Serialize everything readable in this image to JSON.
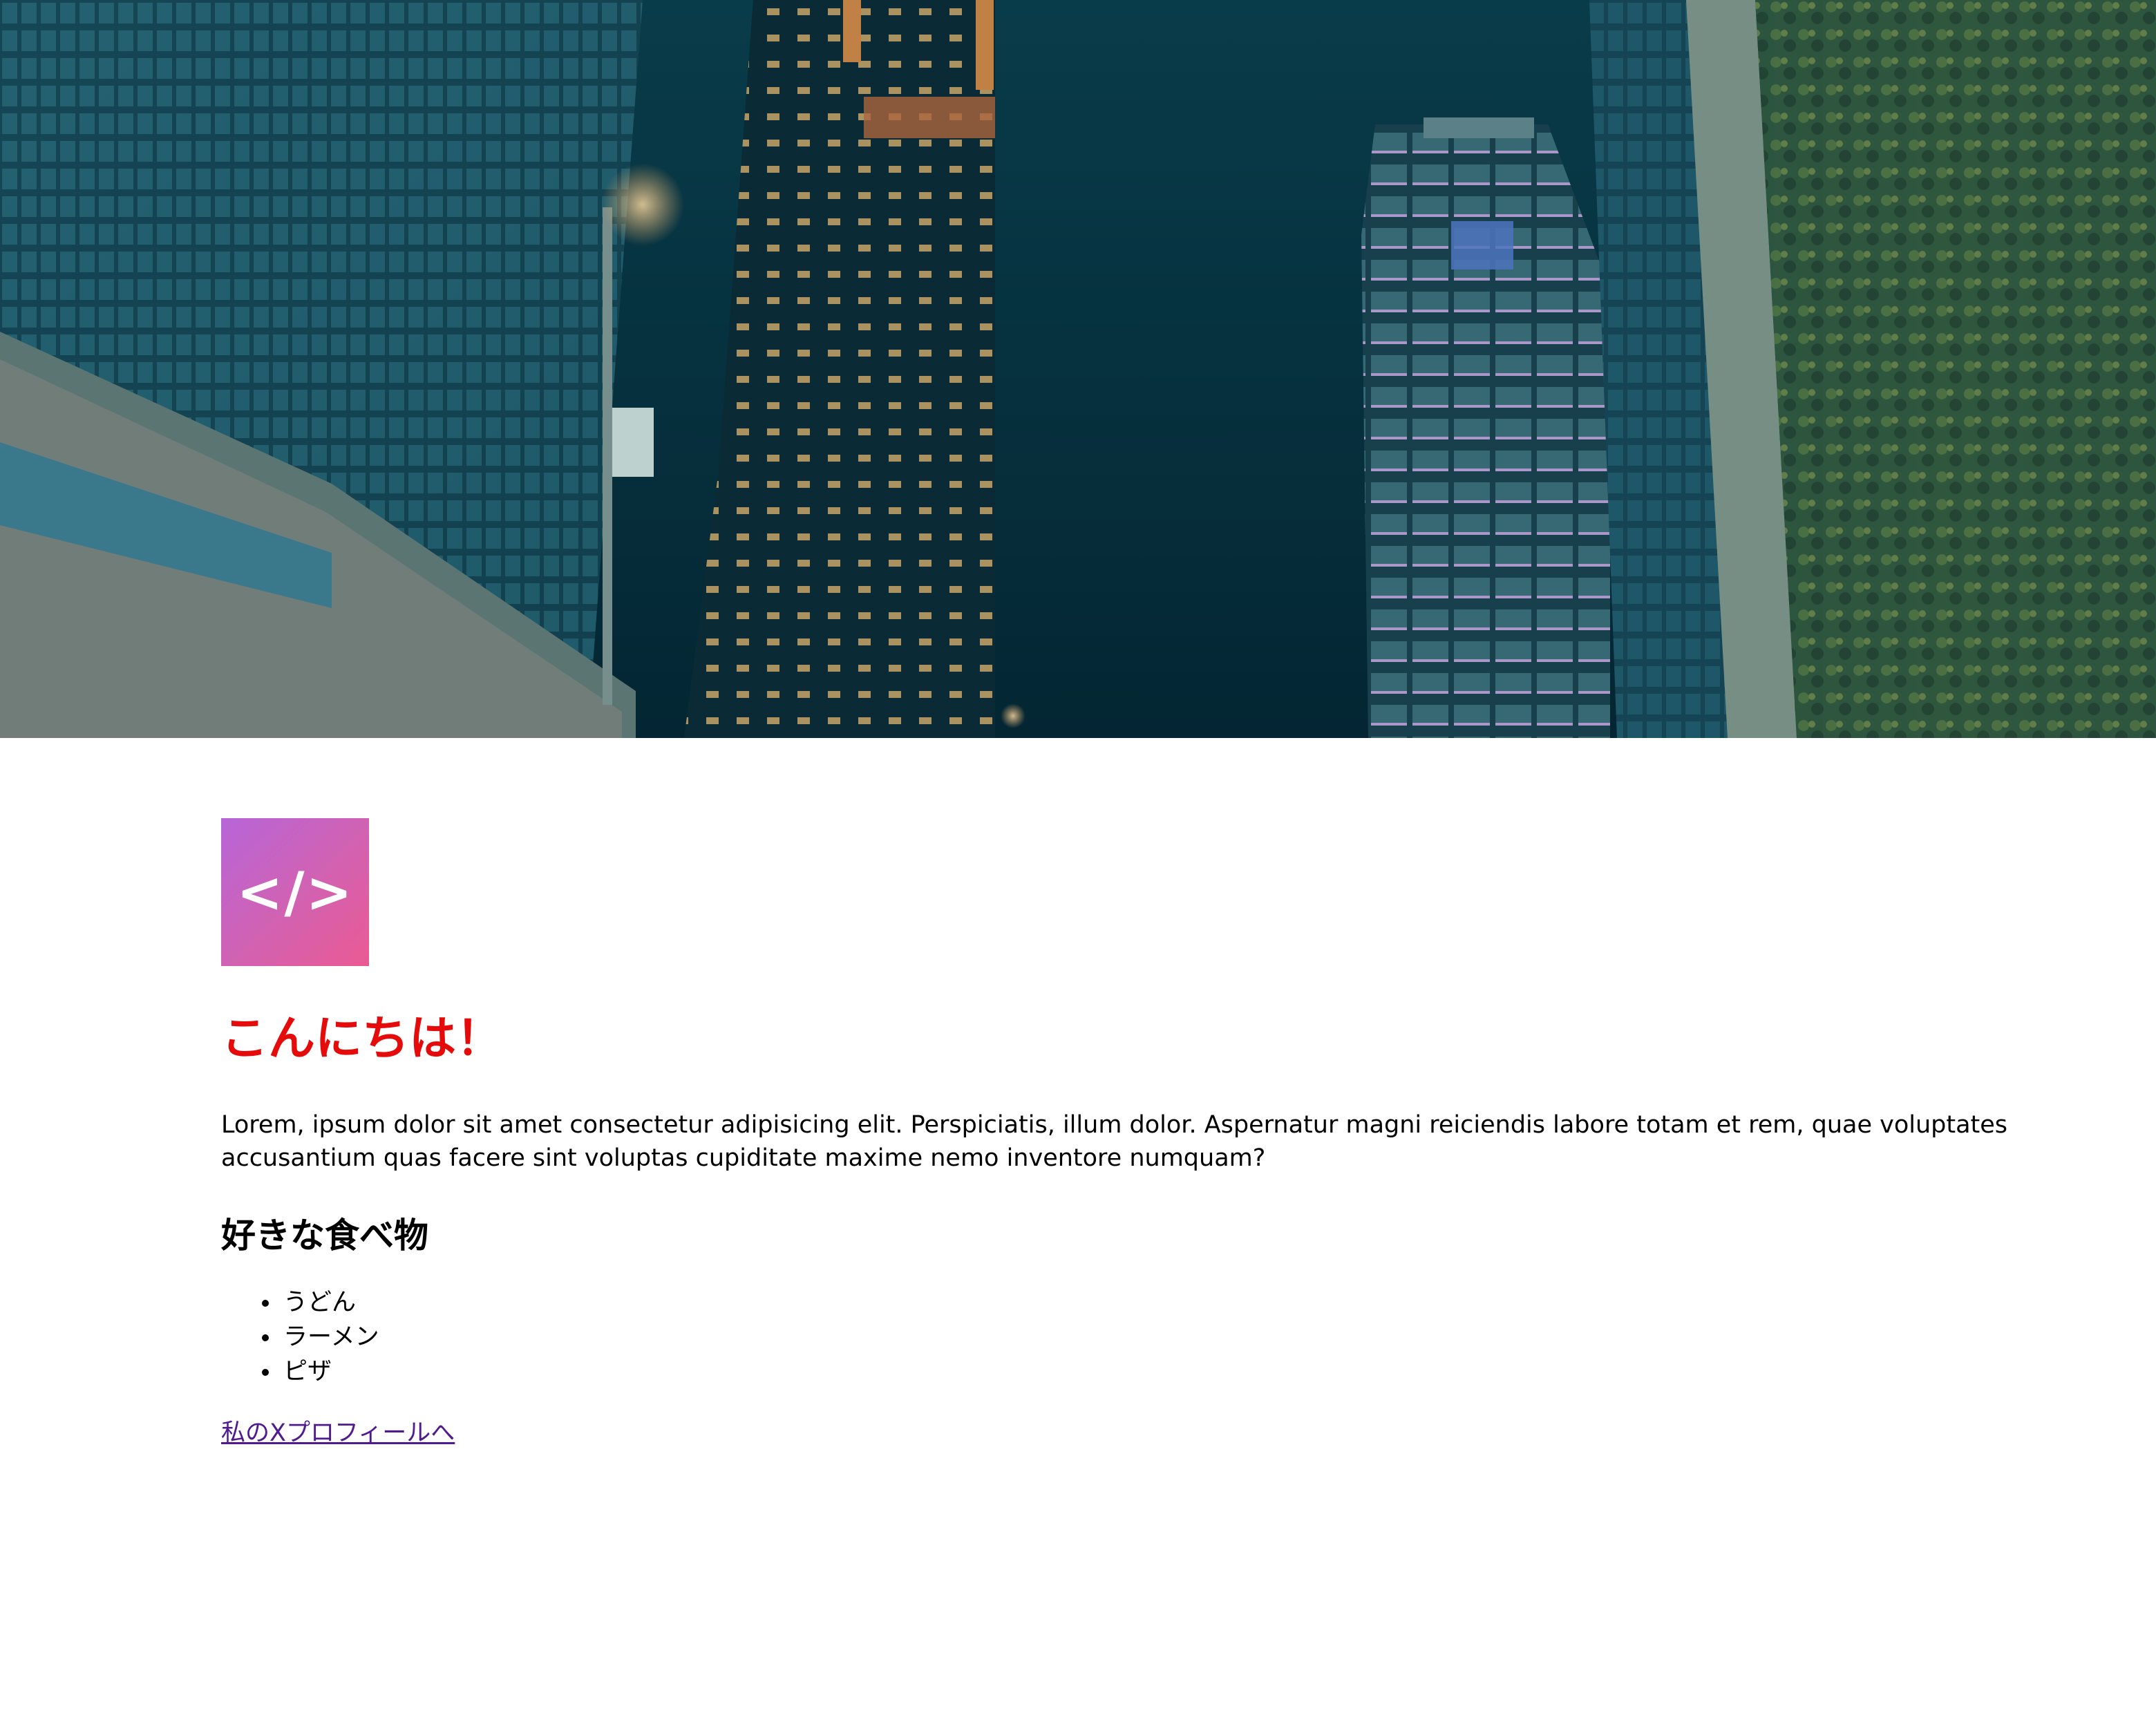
{
  "hero": {
    "image_alt": "night city skyline"
  },
  "logo": {
    "symbol": "</>",
    "gradient_start": "#b765d9",
    "gradient_end": "#ea5a93"
  },
  "heading": {
    "text": "こんにちは！",
    "color": "#e50b0b"
  },
  "paragraph": "Lorem, ipsum dolor sit amet consectetur adipisicing elit. Perspiciatis, illum dolor. Aspernatur magni reiciendis labore totam et rem, quae voluptates accusantium quas facere sint voluptas cupiditate maxime nemo inventore numquam?",
  "favorites": {
    "heading": "好きな食べ物",
    "items": [
      "うどん",
      "ラーメン",
      "ピザ"
    ]
  },
  "link": {
    "text": "私のXプロフィールへ",
    "color": "#4f1b8f"
  }
}
